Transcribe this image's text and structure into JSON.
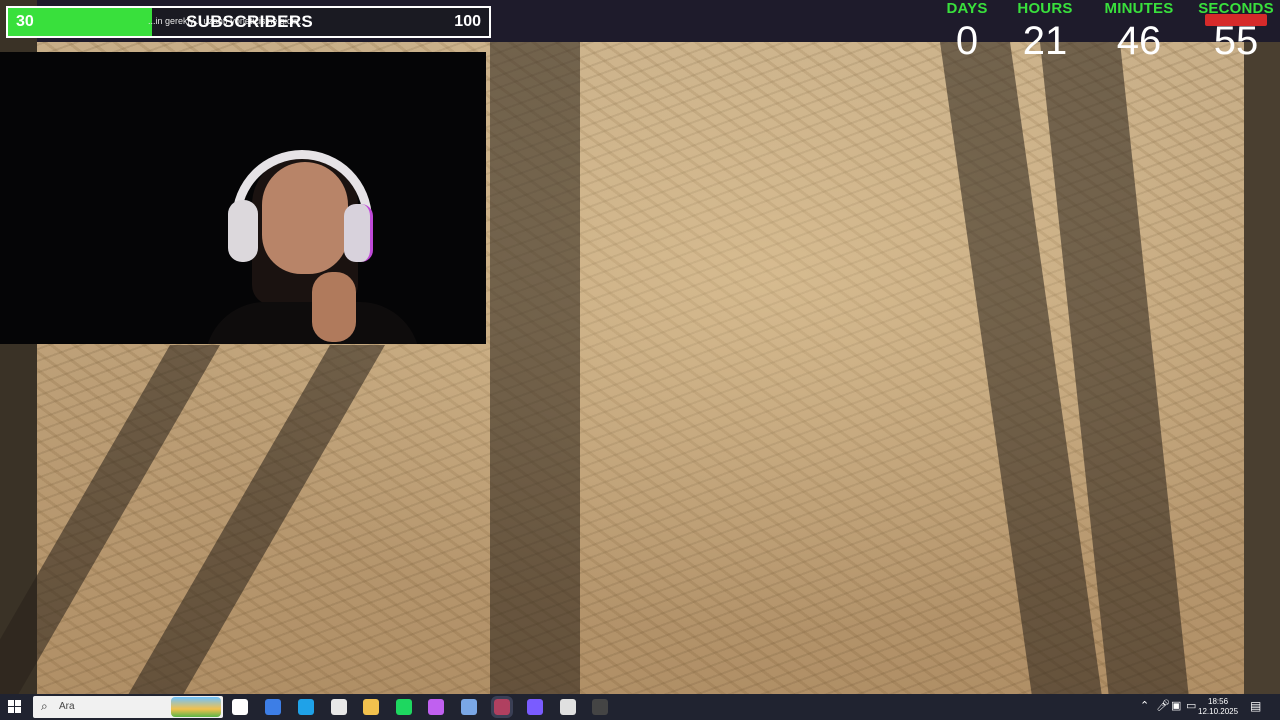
{
  "subscribers": {
    "min": "30",
    "label": "SUBSCRIBERS",
    "max": "100",
    "progress_percent": 30,
    "ticker": "...in gerekiy... uzantı yöneticisine gidin."
  },
  "countdown": {
    "units": [
      {
        "label": "DAYS",
        "value": "0"
      },
      {
        "label": "HOURS",
        "value": "21"
      },
      {
        "label": "MINUTES",
        "value": "46"
      },
      {
        "label": "SECONDS",
        "value": "55"
      }
    ]
  },
  "taskbar": {
    "search_placeholder": "Ara",
    "time": "18:56",
    "date": "12.10.2025",
    "apps": [
      {
        "name": "task-view-icon",
        "color": "#ffffff"
      },
      {
        "name": "file-icon",
        "color": "#3d7ee6"
      },
      {
        "name": "edge-icon",
        "color": "#1fa2e8"
      },
      {
        "name": "store-icon",
        "color": "#e8e8e8"
      },
      {
        "name": "folder-icon",
        "color": "#f2c14e"
      },
      {
        "name": "spotify-icon",
        "color": "#1ed760"
      },
      {
        "name": "copilot-icon",
        "color": "#c060f0"
      },
      {
        "name": "window-icon",
        "color": "#7aa7e6"
      },
      {
        "name": "app-icon",
        "color": "#b04060"
      },
      {
        "name": "messenger-icon",
        "color": "#7a5cff"
      },
      {
        "name": "app2-icon",
        "color": "#e0e0e0"
      },
      {
        "name": "obs-icon",
        "color": "#444444"
      }
    ]
  },
  "colors": {
    "accent_green": "#39e03c",
    "countdown_red": "#d62a2a"
  }
}
